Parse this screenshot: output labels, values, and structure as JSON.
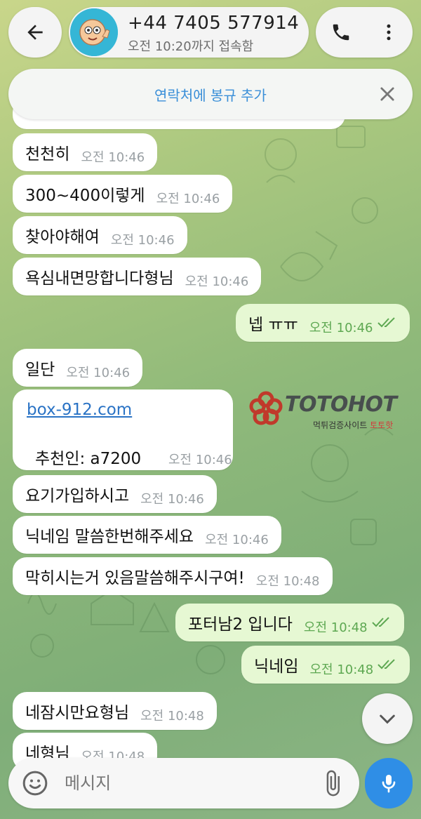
{
  "header": {
    "contact_name": "+44 7405 577914",
    "status": "오전 10:20까지 접속함",
    "avatar_icon": "cartoon-avatar-icon"
  },
  "banner": {
    "text": "연락처에 봉규 추가"
  },
  "messages": [
    {
      "dir": "in",
      "text": "천천히",
      "time": "오전 10:46"
    },
    {
      "dir": "in",
      "text": "300~400이렇게",
      "time": "오전 10:46"
    },
    {
      "dir": "in",
      "text": "찾아야해여",
      "time": "오전 10:46"
    },
    {
      "dir": "in",
      "text": "욕심내면망합니다형님",
      "time": "오전 10:46"
    },
    {
      "dir": "out",
      "text": "넵 ㅠㅠ",
      "time": "오전 10:46"
    },
    {
      "dir": "in",
      "text": "일단",
      "time": "오전 10:46"
    },
    {
      "dir": "in",
      "link": "box-912.com",
      "text": "추천인: a7200",
      "time": "오전 10:46"
    },
    {
      "dir": "in",
      "text": "요기가입하시고",
      "time": "오전 10:46"
    },
    {
      "dir": "in",
      "text": "닉네임 말씀한번해주세요",
      "time": "오전 10:46"
    },
    {
      "dir": "in",
      "text": "막히시는거 있음말씀해주시구여!",
      "time": "오전 10:48"
    },
    {
      "dir": "out",
      "text": "포터남2 입니다",
      "time": "오전 10:48"
    },
    {
      "dir": "out",
      "text": "닉네임",
      "time": "오전 10:48"
    },
    {
      "dir": "in",
      "text": "네잠시만요형님",
      "time": "오전 10:48"
    },
    {
      "dir": "in",
      "text": "네형님",
      "time": "오전 10:48"
    }
  ],
  "watermark": {
    "brand": "TOTOHOT",
    "sub_prefix": "먹튀검증사이트 ",
    "sub_suffix": "토토핫"
  },
  "composer": {
    "placeholder": "메시지"
  },
  "colors": {
    "accent": "#2f8ee6",
    "outgoing_bubble": "#e6f8d3",
    "incoming_bubble": "#ffffff",
    "check_green": "#5ea852"
  }
}
